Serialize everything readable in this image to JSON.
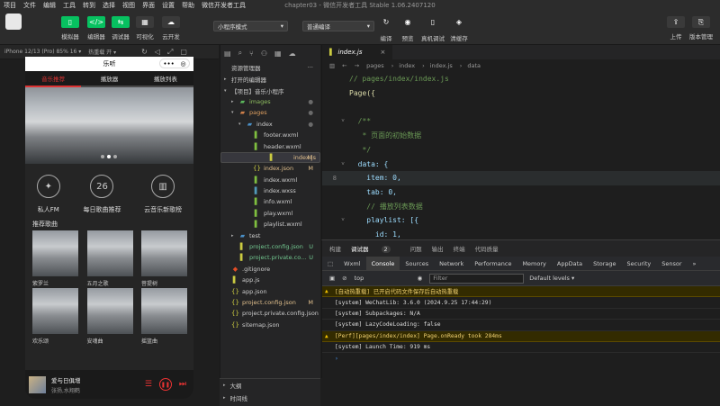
{
  "menu": [
    "项目",
    "文件",
    "编辑",
    "工具",
    "转到",
    "选择",
    "视图",
    "界面",
    "设置",
    "帮助",
    "微信开发者工具"
  ],
  "window_title": "chapter03 - 微信开发者工具 Stable 1.06.2407120",
  "toolbar": {
    "left": [
      "模拟器",
      "编辑器",
      "调试器",
      "可视化",
      "云开发"
    ],
    "mode_select": "小程序模式",
    "compile_select": "普通编译",
    "mid": [
      "编译",
      "预览",
      "真机调试",
      "清缓存"
    ],
    "right": [
      "上传",
      "版本管理"
    ]
  },
  "sim": {
    "device": "iPhone 12/13 (Pro) 85% 16 ▾",
    "hot_reload": "热重载 开 ▾"
  },
  "phone": {
    "nav_title": "乐听",
    "tabs": [
      "音乐推荐",
      "播放器",
      "播放列表"
    ],
    "quick": [
      {
        "icon": "✦",
        "label": "私人FM"
      },
      {
        "icon": "26",
        "label": "每日歌曲推荐"
      },
      {
        "icon": "▥",
        "label": "云音乐新歌榜"
      }
    ],
    "rec_title": "推荐歌曲",
    "row1": [
      "紫罗兰",
      "五月之歌",
      "菩提树"
    ],
    "row2": [
      "欢乐颂",
      "安魂曲",
      "摇篮曲"
    ],
    "player": {
      "song": "爱与日俱增",
      "singer": "张扬,水翔鹤"
    }
  },
  "explorer": {
    "title": "资源管理器",
    "items": [
      {
        "indent": 0,
        "tw": "▸",
        "icon": "",
        "name": "打开的编辑器",
        "color": "#ccc",
        "mark": ""
      },
      {
        "indent": 0,
        "tw": "▾",
        "icon": "",
        "name": "【项目】音乐小程序",
        "color": "#ccc",
        "mark": ""
      },
      {
        "indent": 1,
        "tw": "▸",
        "icon": "▰",
        "name": "images",
        "color": "#8fbf5f",
        "mark": "●",
        "icolor": "#5cb85c"
      },
      {
        "indent": 1,
        "tw": "▾",
        "icon": "▰",
        "name": "pages",
        "color": "#e0a060",
        "mark": "●",
        "icolor": "#d0804a"
      },
      {
        "indent": 2,
        "tw": "▾",
        "icon": "▰",
        "name": "index",
        "color": "#ccc",
        "mark": "●",
        "icolor": "#4a90c8"
      },
      {
        "indent": 3,
        "tw": "",
        "icon": "▌",
        "name": "footer.wxml",
        "color": "#ccc",
        "mark": "",
        "icolor": "#7fbf3f"
      },
      {
        "indent": 3,
        "tw": "",
        "icon": "▌",
        "name": "header.wxml",
        "color": "#ccc",
        "mark": "",
        "icolor": "#7fbf3f"
      },
      {
        "indent": 3,
        "tw": "",
        "icon": "▌",
        "name": "index.js",
        "color": "#e2c08d",
        "mark": "M",
        "icolor": "#cbcb41",
        "sel": true
      },
      {
        "indent": 3,
        "tw": "",
        "icon": "{}",
        "name": "index.json",
        "color": "#e2c08d",
        "mark": "M",
        "icolor": "#cbcb41"
      },
      {
        "indent": 3,
        "tw": "",
        "icon": "▌",
        "name": "index.wxml",
        "color": "#ccc",
        "mark": "",
        "icolor": "#7fbf3f"
      },
      {
        "indent": 3,
        "tw": "",
        "icon": "▌",
        "name": "index.wxss",
        "color": "#ccc",
        "mark": "",
        "icolor": "#519aba"
      },
      {
        "indent": 3,
        "tw": "",
        "icon": "▌",
        "name": "info.wxml",
        "color": "#ccc",
        "mark": "",
        "icolor": "#7fbf3f"
      },
      {
        "indent": 3,
        "tw": "",
        "icon": "▌",
        "name": "play.wxml",
        "color": "#ccc",
        "mark": "",
        "icolor": "#7fbf3f"
      },
      {
        "indent": 3,
        "tw": "",
        "icon": "▌",
        "name": "playlist.wxml",
        "color": "#ccc",
        "mark": "",
        "icolor": "#7fbf3f"
      },
      {
        "indent": 1,
        "tw": "▸",
        "icon": "▰",
        "name": "test",
        "color": "#ccc",
        "mark": "",
        "icolor": "#4a90c8"
      },
      {
        "indent": 1,
        "tw": "",
        "icon": "▌",
        "name": "project.config.json",
        "color": "#73c991",
        "mark": "U",
        "icolor": "#cbcb41"
      },
      {
        "indent": 1,
        "tw": "",
        "icon": "▌",
        "name": "project.private.co...",
        "color": "#73c991",
        "mark": "U",
        "icolor": "#cbcb41"
      },
      {
        "indent": 0,
        "tw": "",
        "icon": "◆",
        "name": ".gitignore",
        "color": "#ccc",
        "mark": "",
        "icolor": "#e44d26"
      },
      {
        "indent": 0,
        "tw": "",
        "icon": "▌",
        "name": "app.js",
        "color": "#ccc",
        "mark": "",
        "icolor": "#cbcb41"
      },
      {
        "indent": 0,
        "tw": "",
        "icon": "{}",
        "name": "app.json",
        "color": "#ccc",
        "mark": "",
        "icolor": "#cbcb41"
      },
      {
        "indent": 0,
        "tw": "",
        "icon": "{}",
        "name": "project.config.json",
        "color": "#e2c08d",
        "mark": "M",
        "icolor": "#cbcb41"
      },
      {
        "indent": 0,
        "tw": "",
        "icon": "{}",
        "name": "project.private.config.json",
        "color": "#ccc",
        "mark": "",
        "icolor": "#cbcb41"
      },
      {
        "indent": 0,
        "tw": "",
        "icon": "{}",
        "name": "sitemap.json",
        "color": "#ccc",
        "mark": "",
        "icolor": "#cbcb41"
      }
    ],
    "outline": [
      "大纲",
      "时间线"
    ]
  },
  "editor": {
    "tab": "index.js",
    "breadcrumb": [
      "pages",
      "index",
      "index.js",
      "data"
    ],
    "lines": [
      {
        "n": "",
        "cls": "c-com",
        "t": "// pages/index/index.js",
        "fold": ""
      },
      {
        "n": "",
        "cls": "c-fn",
        "t": "Page({",
        "fold": ""
      },
      {
        "n": "",
        "cls": "c-pun",
        "t": "",
        "fold": ""
      },
      {
        "n": "",
        "cls": "c-com",
        "t": "  /**",
        "fold": "˅"
      },
      {
        "n": "",
        "cls": "c-com",
        "t": "   * 页面的初始数据",
        "fold": ""
      },
      {
        "n": "",
        "cls": "c-com",
        "t": "   */",
        "fold": ""
      },
      {
        "n": "",
        "cls": "c-key",
        "t": "  data: {",
        "fold": "˅"
      },
      {
        "n": "8",
        "cls": "c-key",
        "t": "    item: 0,",
        "fold": "",
        "cur": true
      },
      {
        "n": "",
        "cls": "c-key",
        "t": "    tab: 0,",
        "fold": ""
      },
      {
        "n": "",
        "cls": "c-com",
        "t": "    // 播放列表数据",
        "fold": ""
      },
      {
        "n": "",
        "cls": "c-key",
        "t": "    playlist: [{",
        "fold": "˅"
      },
      {
        "n": "",
        "cls": "c-key",
        "t": "      id: 1,",
        "fold": ""
      }
    ]
  },
  "devtools": {
    "top_tabs": [
      "构建",
      "调试器",
      "问题",
      "输出",
      "终端",
      "代码质量"
    ],
    "badge": "2",
    "tabs": [
      "Wxml",
      "Console",
      "Sources",
      "Network",
      "Performance",
      "Memory",
      "AppData",
      "Storage",
      "Security",
      "Sensor",
      "»"
    ],
    "context": "top",
    "filter_placeholder": "Filter",
    "levels": "Default levels ▾",
    "logs": [
      {
        "warn": true,
        "t": "[自动热重载] 已开启代码文件保存后自动热重载"
      },
      {
        "warn": false,
        "t": "[system] WeChatLib: 3.6.0 (2024.9.25 17:44:29)"
      },
      {
        "warn": false,
        "t": "[system] Subpackages: N/A"
      },
      {
        "warn": false,
        "t": "[system] LazyCodeLoading: false"
      },
      {
        "warn": true,
        "t": "[Perf][pages/index/index] Page.onReady took 284ms"
      },
      {
        "warn": false,
        "t": "[system] Launch Time: 919 ms"
      }
    ],
    "prompt": "›"
  }
}
